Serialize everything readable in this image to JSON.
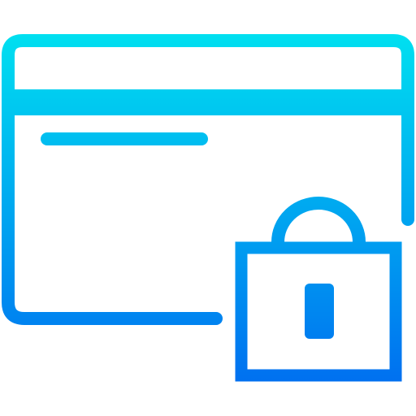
{
  "icon": {
    "semantic": "secure-credit-card-icon",
    "parts": [
      "credit-card-outline-icon",
      "magnetic-stripe",
      "card-text-line",
      "padlock-icon",
      "padlock-shackle",
      "padlock-keyhole"
    ]
  },
  "colors": {
    "gradient_top": "#00E0F0",
    "gradient_bottom": "#0070F0",
    "background": "#FFFFFF"
  }
}
